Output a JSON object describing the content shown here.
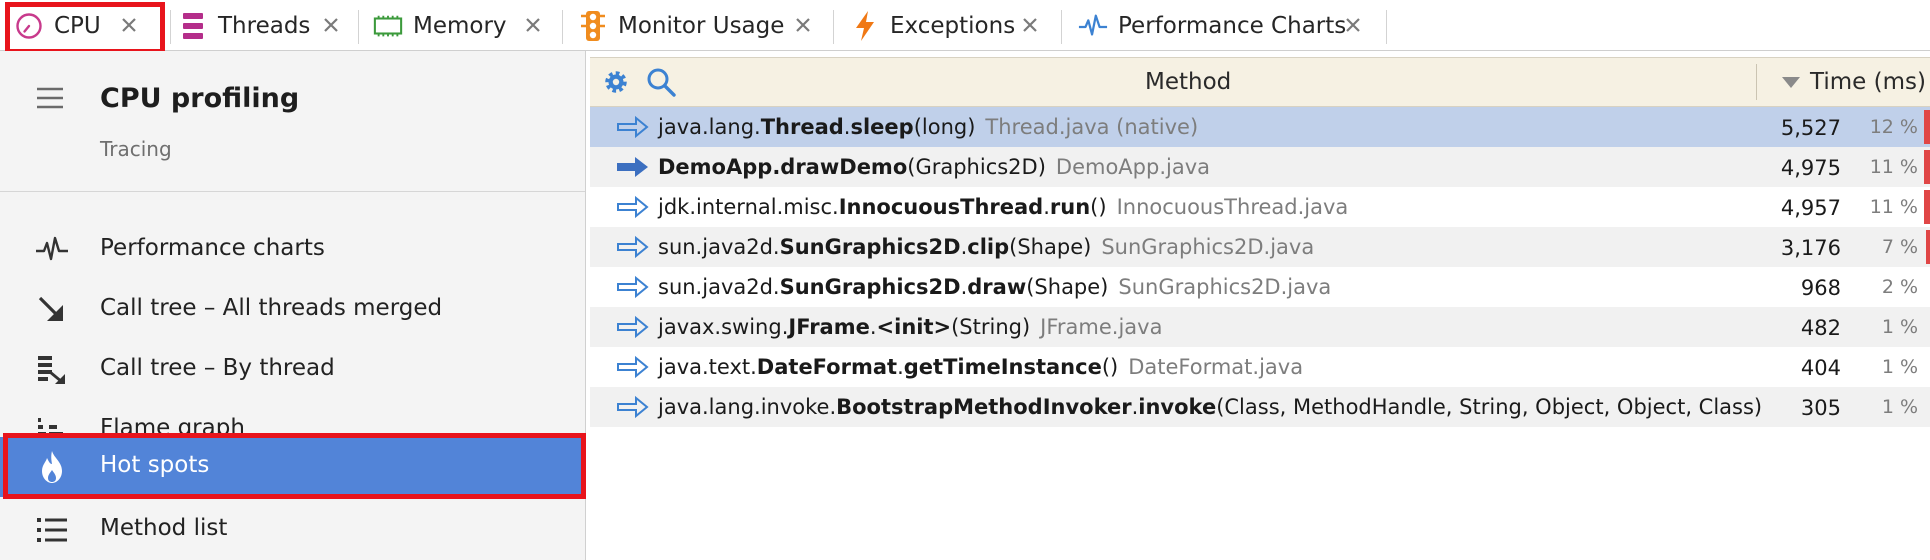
{
  "tabs": [
    {
      "label": "CPU",
      "icon": "clock-icon",
      "color": "#c83a8c"
    },
    {
      "label": "Threads",
      "icon": "threads-icon",
      "color": "#b42e8a"
    },
    {
      "label": "Memory",
      "icon": "memory-chip-icon",
      "color": "#3c9a3c"
    },
    {
      "label": "Monitor Usage",
      "icon": "traffic-light-icon",
      "color": "#f08c1e"
    },
    {
      "label": "Exceptions",
      "icon": "lightning-icon",
      "color": "#f07814"
    },
    {
      "label": "Performance Charts",
      "icon": "pulse-icon",
      "color": "#3c82d2"
    }
  ],
  "sidebar": {
    "title": "CPU profiling",
    "subtitle": "Tracing",
    "items": [
      {
        "label": "Performance charts",
        "icon": "pulse-icon"
      },
      {
        "label": "Call tree – All threads merged",
        "icon": "arrow-down-right-icon"
      },
      {
        "label": "Call tree – By thread",
        "icon": "thread-tree-icon"
      },
      {
        "label": "Flame graph",
        "icon": "flame-graph-icon"
      },
      {
        "label": "Hot spots",
        "icon": "flame-icon",
        "selected": true
      },
      {
        "label": "Method list",
        "icon": "list-icon"
      }
    ]
  },
  "table": {
    "col_method": "Method",
    "col_time": "Time (ms)",
    "rows": [
      {
        "pkg": "java.lang.",
        "cls": "Thread",
        "sep": ".",
        "mname": "sleep",
        "args": "(long)",
        "file": "Thread.java (native)",
        "time": "5,527",
        "pct": "12 %",
        "pct_value": 12,
        "pkg_bold": false
      },
      {
        "pkg": "",
        "cls": "DemoApp",
        "sep": ".",
        "mname": "drawDemo",
        "args": "(Graphics2D)",
        "file": "DemoApp.java",
        "time": "4,975",
        "pct": "11 %",
        "pct_value": 11,
        "pkg_bold": true
      },
      {
        "pkg": "jdk.internal.misc.",
        "cls": "InnocuousThread",
        "sep": ".",
        "mname": "run",
        "args": "()",
        "file": "InnocuousThread.java",
        "time": "4,957",
        "pct": "11 %",
        "pct_value": 11,
        "pkg_bold": false
      },
      {
        "pkg": "sun.java2d.",
        "cls": "SunGraphics2D",
        "sep": ".",
        "mname": "clip",
        "args": "(Shape)",
        "file": "SunGraphics2D.java",
        "time": "3,176",
        "pct": "7 %",
        "pct_value": 7,
        "pkg_bold": false
      },
      {
        "pkg": "sun.java2d.",
        "cls": "SunGraphics2D",
        "sep": ".",
        "mname": "draw",
        "args": "(Shape)",
        "file": "SunGraphics2D.java",
        "time": "968",
        "pct": "2 %",
        "pct_value": 2,
        "pkg_bold": false
      },
      {
        "pkg": "javax.swing.",
        "cls": "JFrame",
        "sep": ".",
        "mname": "<init>",
        "args": "(String)",
        "file": "JFrame.java",
        "time": "482",
        "pct": "1 %",
        "pct_value": 1,
        "pkg_bold": false
      },
      {
        "pkg": "java.text.",
        "cls": "DateFormat",
        "sep": ".",
        "mname": "getTimeInstance",
        "args": "()",
        "file": "DateFormat.java",
        "time": "404",
        "pct": "1 %",
        "pct_value": 1,
        "pkg_bold": false
      },
      {
        "pkg": "java.lang.invoke.",
        "cls": "BootstrapMethodInvoker",
        "sep": ".",
        "mname": "invoke",
        "args": "(Class, MethodHandle, String, Object, Object, Class)",
        "file": "",
        "time": "305",
        "pct": "1 %",
        "pct_value": 1,
        "pkg_bold": false
      }
    ]
  },
  "colors": {
    "selection_blue": "#5284d8",
    "row_selected": "#c0d0ea",
    "highlight_red": "#e8141c",
    "header_beige": "#f6f1e3",
    "percent_bar": "#e04646"
  }
}
